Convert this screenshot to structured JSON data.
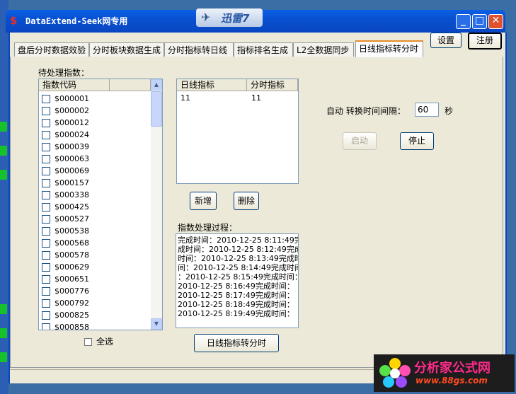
{
  "window": {
    "title": "DataExtend-Seek网专用",
    "app_icon": "$",
    "minimize": "_",
    "maximize": "□",
    "close": "✕"
  },
  "xunlei_badge": {
    "text": "迅雷7"
  },
  "header_buttons": {
    "settings": "设置",
    "register": "注册"
  },
  "tabs": [
    {
      "label": "盘后分时数据效验"
    },
    {
      "label": "分时板块数据生成"
    },
    {
      "label": "分时指标转日线"
    },
    {
      "label": "指标排名生成"
    },
    {
      "label": "L2全数据同步"
    },
    {
      "label": "日线指标转分时",
      "active": true
    }
  ],
  "pending": {
    "label": "待处理指数：",
    "column": "指数代码",
    "codes": [
      "$000001",
      "$000002",
      "$000012",
      "$000024",
      "$000039",
      "$000063",
      "$000069",
      "$000157",
      "$000338",
      "$000425",
      "$000527",
      "$000538",
      "$000568",
      "$000578",
      "$000629",
      "$000651",
      "$000776",
      "$000792",
      "$000825",
      "$000858"
    ]
  },
  "mapping": {
    "headers": [
      "日线指标",
      "分时指标"
    ],
    "rows": [
      [
        "11",
        "11"
      ]
    ]
  },
  "buttons": {
    "add": "新增",
    "delete": "删除",
    "start": "启动",
    "stop": "停止",
    "convert": "日线指标转分时"
  },
  "select_all": "全选",
  "interval": {
    "label": "自动 转换时间间隔：",
    "value": "60",
    "unit": "秒"
  },
  "log": {
    "label": "指数处理过程：",
    "lines": [
      "完成时间：2010-12-25 8:11:49完",
      "成时间：2010-12-25 8:12:49完成",
      "时间：2010-12-25 8:13:49完成时",
      "间：2010-12-25 8:14:49完成时间",
      "：2010-12-25 8:15:49完成时间：",
      "2010-12-25 8:16:49完成时间：",
      "2010-12-25 8:17:49完成时间：",
      "2010-12-25 8:18:49完成时间：",
      "2010-12-25 8:19:49完成时间："
    ]
  },
  "watermark": {
    "main": "分析家公式网",
    "url": "www.88gs.com"
  },
  "colors": {
    "titlebar": "#0a5fe5",
    "tab_active_accent": "#e68b2c",
    "watermark_pink": "#ff2a8a",
    "watermark_orange": "#ff4a22"
  }
}
